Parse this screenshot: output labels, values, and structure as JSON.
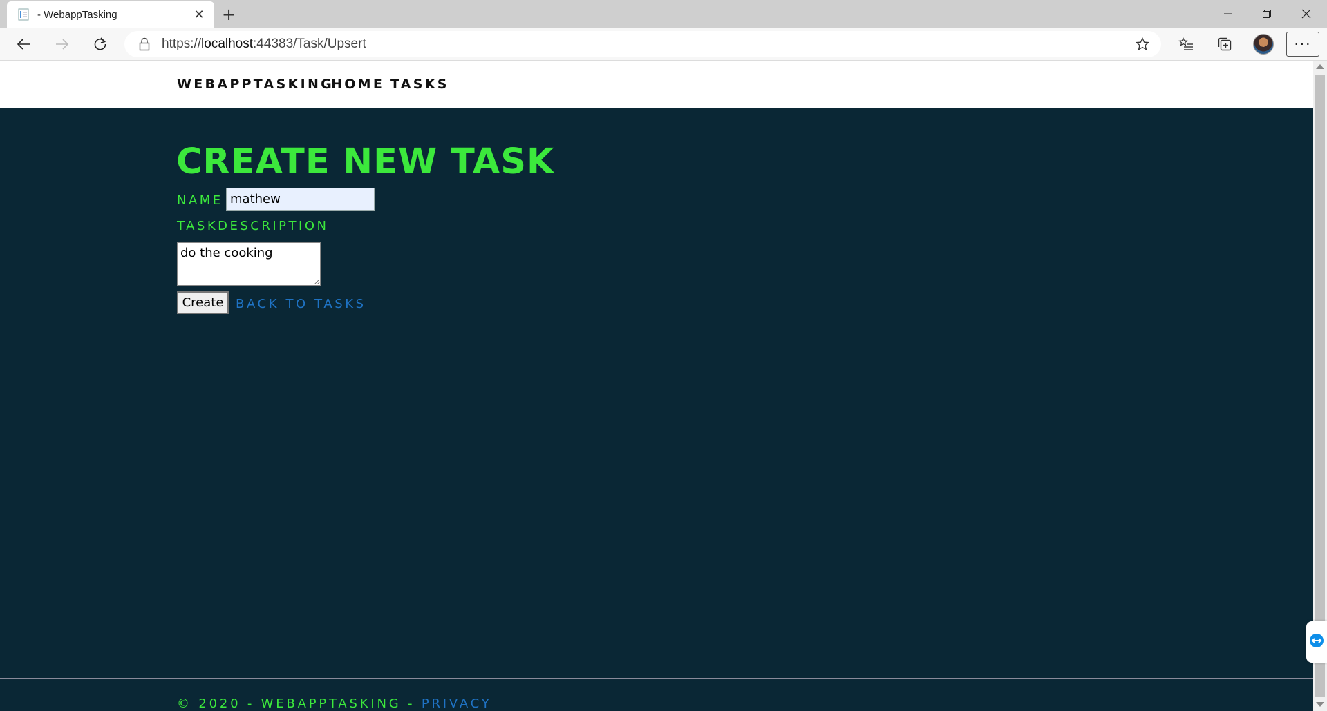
{
  "browser": {
    "tab_title": "- WebappTasking",
    "url_scheme": "https://",
    "url_host": "localhost",
    "url_rest": ":44383/Task/Upsert"
  },
  "site_nav": {
    "brand": "WEBAPPTASKING",
    "home": "HOME",
    "tasks": "TASKS"
  },
  "form": {
    "title": "CREATE NEW TASK",
    "name_label": "NAME",
    "name_value": "mathew",
    "description_label": "TASKDESCRIPTION",
    "description_value": "do the cooking",
    "create_label": "Create",
    "back_label": "BACK TO TASKS"
  },
  "footer": {
    "text": "© 2020 - WEBAPPTASKING - ",
    "privacy": "PRIVACY"
  },
  "colors": {
    "page_background": "#0a2735",
    "accent_green": "#3ce83c",
    "link_blue": "#1f73c4"
  }
}
